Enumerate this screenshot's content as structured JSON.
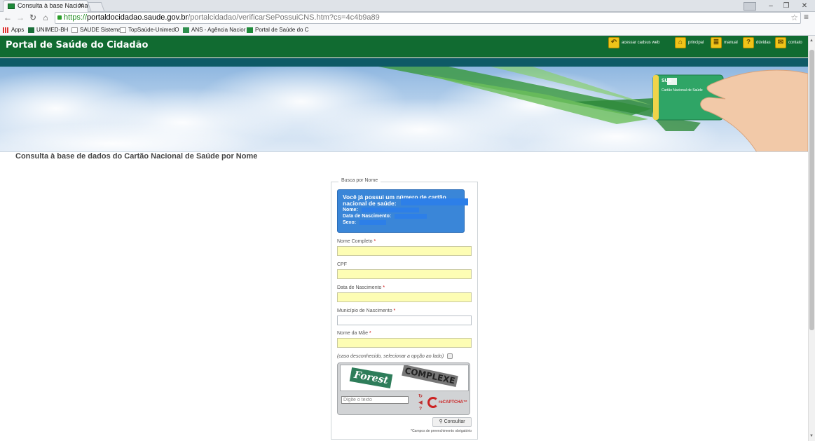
{
  "browser": {
    "tab_title": "Consulta à base Nacional",
    "url_https": "https://",
    "url_host": "portaldocidadao.saude.gov.br",
    "url_path": "/portalcidadao/verificarSePossuiCNS.htm?cs=4c4b9a89"
  },
  "bookmarks": [
    {
      "label": "Apps"
    },
    {
      "label": "UNIMED-BH"
    },
    {
      "label": "SAUDE Sistema"
    },
    {
      "label": "TopSaúde-UnimedO"
    },
    {
      "label": "ANS - Agência Nacior"
    },
    {
      "label": "Portal de Saúde do C"
    }
  ],
  "header": {
    "site_title": "Portal de Saúde do Cidadão",
    "links": {
      "cadsus": "acessar cadsus web",
      "principal": "principal",
      "manual": "manual",
      "duvidas": "dúvidas",
      "contato": "contato"
    }
  },
  "banner": {
    "card_brand": "SUS",
    "card_title": "Cartão Nacional de Saúde"
  },
  "page": {
    "heading": "Consulta à base de dados do Cartão Nacional de Saúde por Nome"
  },
  "form": {
    "legend": "Busca por Nome",
    "notice": {
      "question": "Você já possui um número de cartão nacional de saúde:",
      "nome_label": "Nome:",
      "nascimento_label": "Data de Nascimento:",
      "sexo_label": "Sexo:"
    },
    "fields": {
      "nome": "Nome Completo",
      "cpf": "CPF",
      "nascimento": "Data de Nascimento",
      "municipio": "Município de Nascimento",
      "mae": "Nome da Mãe"
    },
    "required_mark": "*",
    "unknown_text": "(caso desconhecido, selecionar a opção ao lado)",
    "captcha": {
      "word1": "Forest",
      "word2": "COMPLEXE",
      "placeholder": "Digite o texto",
      "logo_text": "reCAPTCHA™"
    },
    "submit_label": "Consultar",
    "footnote": "*Campos de preenchimento obrigatório"
  }
}
